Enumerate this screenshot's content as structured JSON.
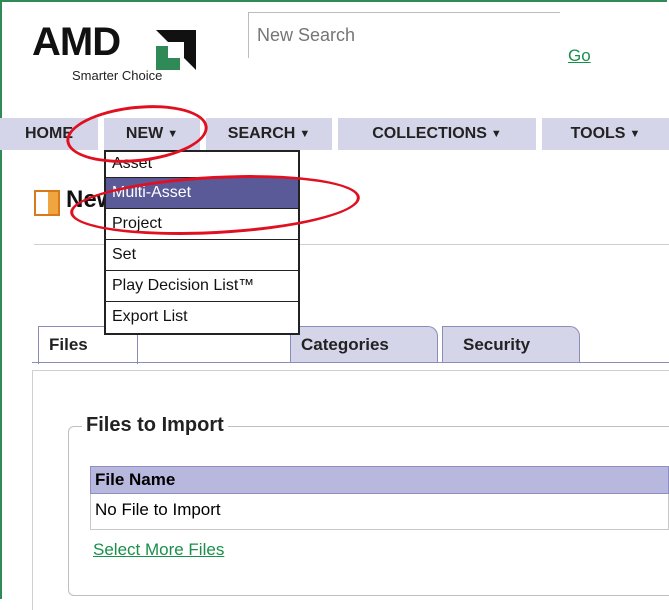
{
  "brand": {
    "name": "AMD",
    "tagline": "Smarter Choice",
    "accent_color": "#2f8a57"
  },
  "search": {
    "placeholder": "New Search",
    "go_label": "Go"
  },
  "nav": {
    "items": [
      {
        "label": "HOME",
        "has_menu": false
      },
      {
        "label": "NEW",
        "has_menu": true
      },
      {
        "label": "SEARCH",
        "has_menu": true
      },
      {
        "label": "COLLECTIONS",
        "has_menu": true
      },
      {
        "label": "TOOLS",
        "has_menu": true
      }
    ],
    "menu_color": "#d5d5ea"
  },
  "new_menu": {
    "items": [
      "Asset",
      "Multi-Asset",
      "Project",
      "Set",
      "Play Decision List™",
      "Export List"
    ],
    "selected": "Multi-Asset",
    "highlight_color": "#5a5a99"
  },
  "page": {
    "title": "New (Multi-Asset)",
    "tabs": [
      "Files",
      "Categories",
      "Security"
    ],
    "active_tab": "Files"
  },
  "files_section": {
    "legend": "Files to Import",
    "column_header": "File Name",
    "empty_row": "No File to Import",
    "select_more_label": "Select More Files"
  },
  "annotations": {
    "color": "#e01020",
    "circled_items": [
      "NEW menu",
      "Multi-Asset menu item"
    ]
  }
}
